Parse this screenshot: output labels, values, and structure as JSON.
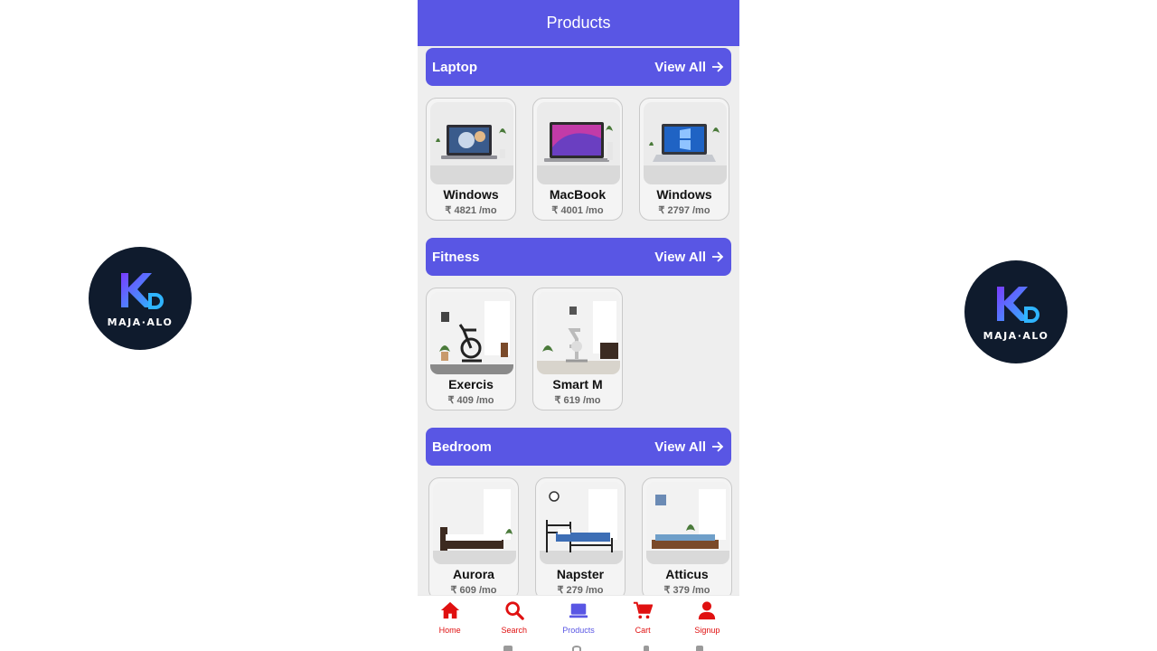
{
  "header": {
    "title": "Products"
  },
  "watermark": {
    "text": "MAJA·ALO"
  },
  "sections": [
    {
      "title": "Laptop",
      "view_all": "View All",
      "items": [
        {
          "name": "Windows",
          "price": "₹ 4821 /mo"
        },
        {
          "name": "MacBook",
          "price": "₹ 4001 /mo"
        },
        {
          "name": "Windows",
          "price": "₹ 2797 /mo"
        }
      ]
    },
    {
      "title": "Fitness",
      "view_all": "View All",
      "items": [
        {
          "name": "Exercis",
          "price": "₹ 409 /mo"
        },
        {
          "name": "Smart M",
          "price": "₹ 619 /mo"
        }
      ]
    },
    {
      "title": "Bedroom",
      "view_all": "View All",
      "items": [
        {
          "name": "Aurora",
          "price": "₹ 609 /mo"
        },
        {
          "name": "Napster",
          "price": "₹ 279 /mo"
        },
        {
          "name": "Atticus",
          "price": "₹ 379 /mo"
        }
      ]
    }
  ],
  "bottom_nav": [
    {
      "label": "Home",
      "icon": "home-icon",
      "active": false
    },
    {
      "label": "Search",
      "icon": "search-icon",
      "active": false
    },
    {
      "label": "Products",
      "icon": "laptop-icon",
      "active": true
    },
    {
      "label": "Cart",
      "icon": "cart-icon",
      "active": false
    },
    {
      "label": "Signup",
      "icon": "user-icon",
      "active": false
    }
  ],
  "colors": {
    "primary": "#5956e4",
    "nav_red": "#e01010",
    "background": "#eeeeee"
  }
}
